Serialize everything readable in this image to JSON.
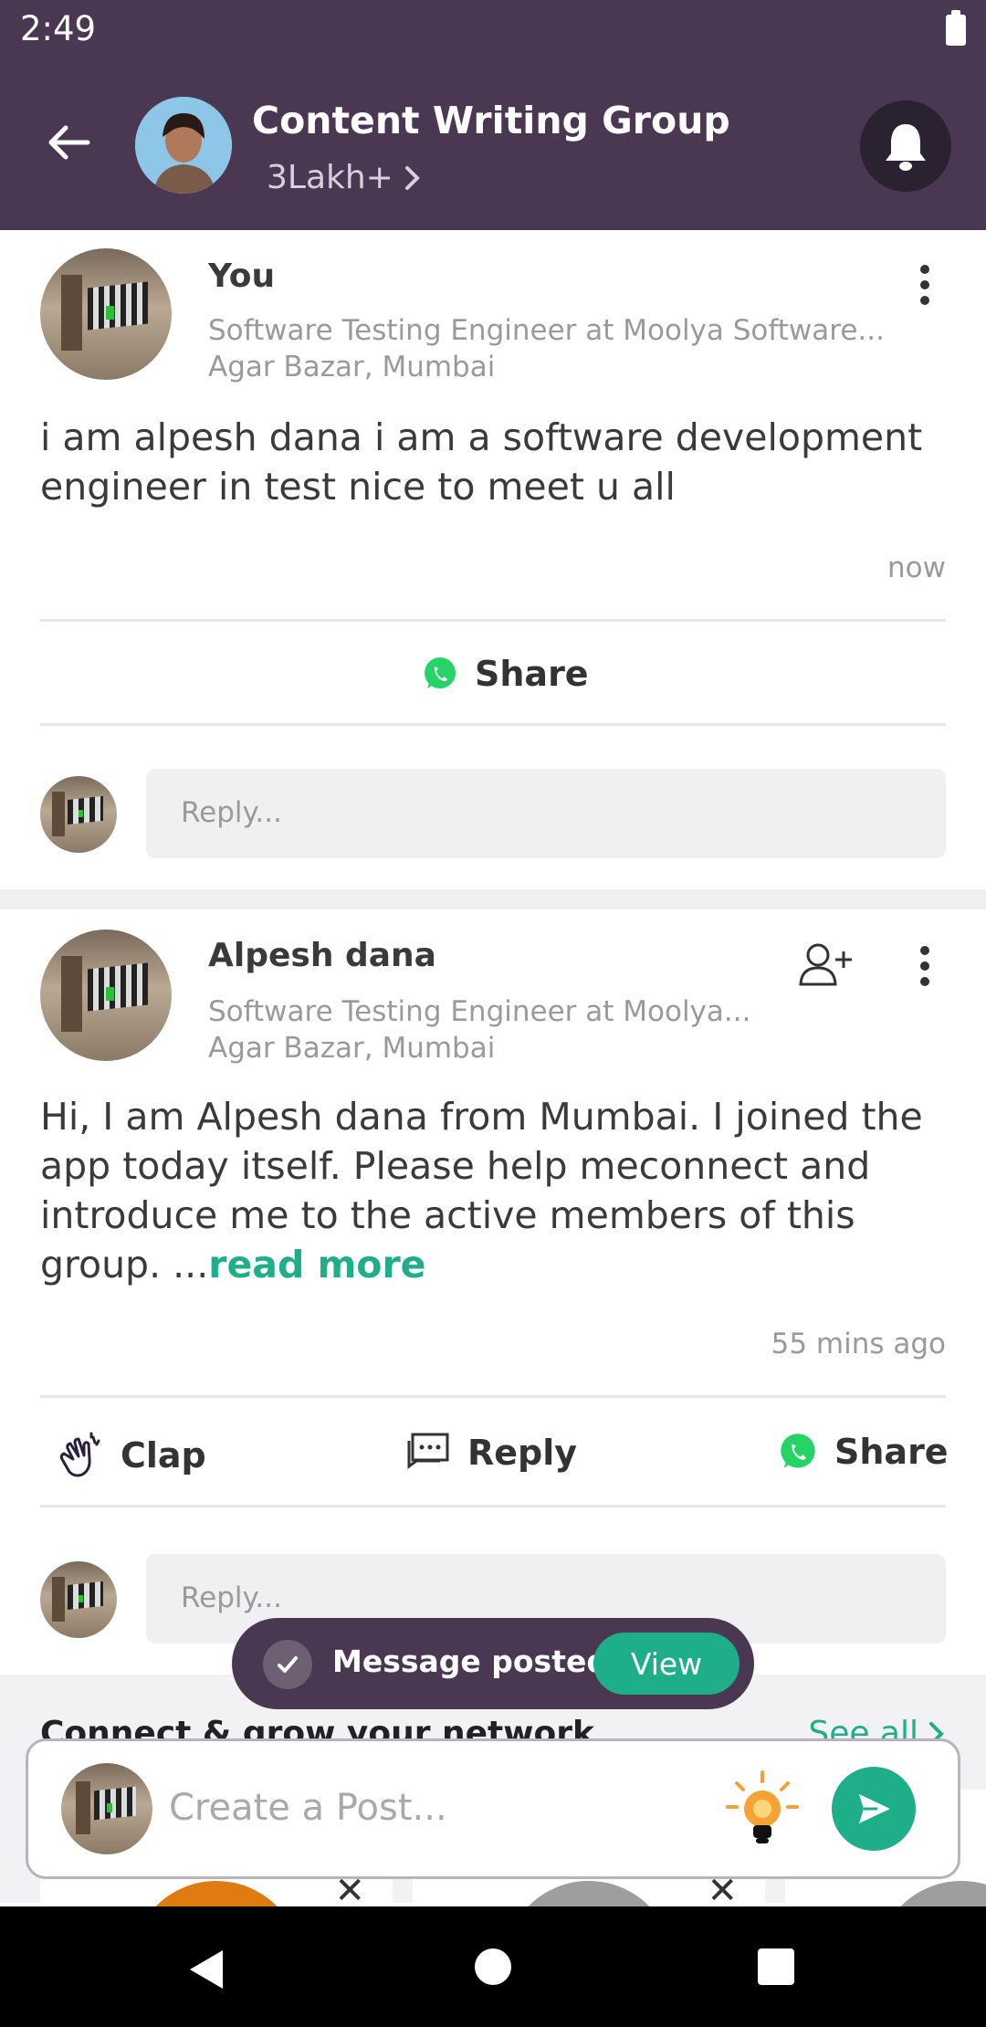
{
  "status_bar": {
    "time": "2:49"
  },
  "header": {
    "title": "Content Writing Group",
    "members": "3Lakh+",
    "accent": "#4a3852"
  },
  "posts": [
    {
      "author": "You",
      "headline": "Software Testing Engineer at Moolya Software...",
      "location": "Agar Bazar, Mumbai",
      "body": "i am alpesh dana i am a software development engineer in test nice to meet u all",
      "time": "now",
      "share_label": "Share",
      "reply_placeholder": "Reply..."
    },
    {
      "author": "Alpesh dana",
      "headline": "Software Testing Engineer at Moolya...",
      "location": "Agar Bazar, Mumbai",
      "body": "Hi, I am Alpesh dana from Mumbai. I joined the app today itself. Please help meconnect and introduce me to the active members of this group.  ...",
      "read_more": "read more",
      "time": "55 mins ago",
      "clap_label": "Clap",
      "reply_label": "Reply",
      "share_label": "Share",
      "reply_placeholder": "Reply..."
    }
  ],
  "toast": {
    "message": "Message posted",
    "action": "View"
  },
  "connect": {
    "title": "Connect & grow your network",
    "see_all": "See all"
  },
  "composer": {
    "placeholder": "Create a Post..."
  },
  "colors": {
    "accent_green": "#1fae8a",
    "whatsapp": "#25d366"
  },
  "icons": [
    "back-arrow-icon",
    "bell-icon",
    "kebab-icon",
    "whatsapp-icon",
    "clap-icon",
    "reply-icon",
    "add-user-icon",
    "check-icon",
    "bulb-icon",
    "send-icon"
  ]
}
